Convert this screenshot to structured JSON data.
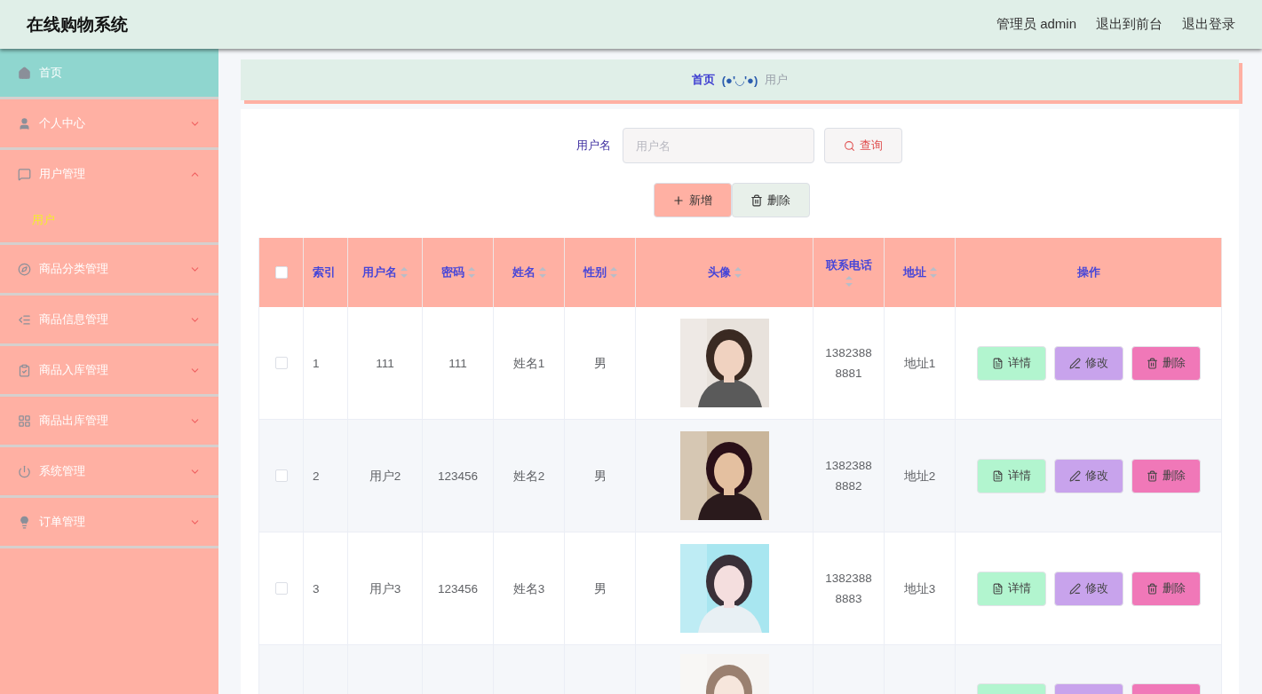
{
  "header": {
    "title": "在线购物系统",
    "user": "管理员 admin",
    "links": [
      "退出到前台",
      "退出登录"
    ]
  },
  "sidebar": {
    "items": [
      {
        "label": "首页",
        "selected": true
      },
      {
        "label": "个人中心",
        "selected": false,
        "expanded": false
      },
      {
        "label": "用户管理",
        "selected": false,
        "expanded": true,
        "children": [
          {
            "label": "用户",
            "selected": true
          }
        ]
      },
      {
        "label": "商品分类管理",
        "selected": false,
        "expanded": false
      },
      {
        "label": "商品信息管理",
        "selected": false,
        "expanded": false
      },
      {
        "label": "商品入库管理",
        "selected": false,
        "expanded": false
      },
      {
        "label": "商品出库管理",
        "selected": false,
        "expanded": false
      },
      {
        "label": "系统管理",
        "selected": false,
        "expanded": false
      },
      {
        "label": "订单管理",
        "selected": false,
        "expanded": false
      }
    ]
  },
  "breadcrumb": {
    "items": [
      {
        "label": "首页",
        "current": false
      },
      {
        "label": "用户",
        "current": true
      }
    ],
    "separator": "(●'◡'●)"
  },
  "search": {
    "label": "用户名",
    "placeholder": "用户名",
    "button": "查询"
  },
  "actions": [
    {
      "kind": "add",
      "label": "新增"
    },
    {
      "kind": "delete",
      "label": "删除"
    }
  ],
  "table": {
    "all_checked": false,
    "columns": [
      {
        "label": "索引",
        "sortable": false
      },
      {
        "label": "用户名",
        "sortable": true
      },
      {
        "label": "密码",
        "sortable": true
      },
      {
        "label": "姓名",
        "sortable": true
      },
      {
        "label": "性别",
        "sortable": true
      },
      {
        "label": "头像",
        "sortable": true
      },
      {
        "label": "联系电话",
        "sortable": true
      },
      {
        "label": "地址",
        "sortable": true
      },
      {
        "label": "操作",
        "sortable": false
      }
    ],
    "rows": [
      {
        "checked": false,
        "index": "1",
        "username": "111",
        "password": "111",
        "name": "姓名1",
        "gender": "男",
        "phone": "13823888881",
        "address": "地址1",
        "actions": [
          {
            "kind": "detail",
            "label": "详情"
          },
          {
            "kind": "edit",
            "label": "修改"
          },
          {
            "kind": "delete",
            "label": "删除"
          }
        ]
      },
      {
        "checked": false,
        "index": "2",
        "username": "用户2",
        "password": "123456",
        "name": "姓名2",
        "gender": "男",
        "phone": "13823888882",
        "address": "地址2",
        "actions": [
          {
            "kind": "detail",
            "label": "详情"
          },
          {
            "kind": "edit",
            "label": "修改"
          },
          {
            "kind": "delete",
            "label": "删除"
          }
        ]
      },
      {
        "checked": false,
        "index": "3",
        "username": "用户3",
        "password": "123456",
        "name": "姓名3",
        "gender": "男",
        "phone": "13823888883",
        "address": "地址3",
        "actions": [
          {
            "kind": "detail",
            "label": "详情"
          },
          {
            "kind": "edit",
            "label": "修改"
          },
          {
            "kind": "delete",
            "label": "删除"
          }
        ]
      }
    ],
    "partial_row": {
      "actions": [
        {
          "kind": "detail"
        },
        {
          "kind": "edit"
        },
        {
          "kind": "delete"
        }
      ]
    }
  }
}
